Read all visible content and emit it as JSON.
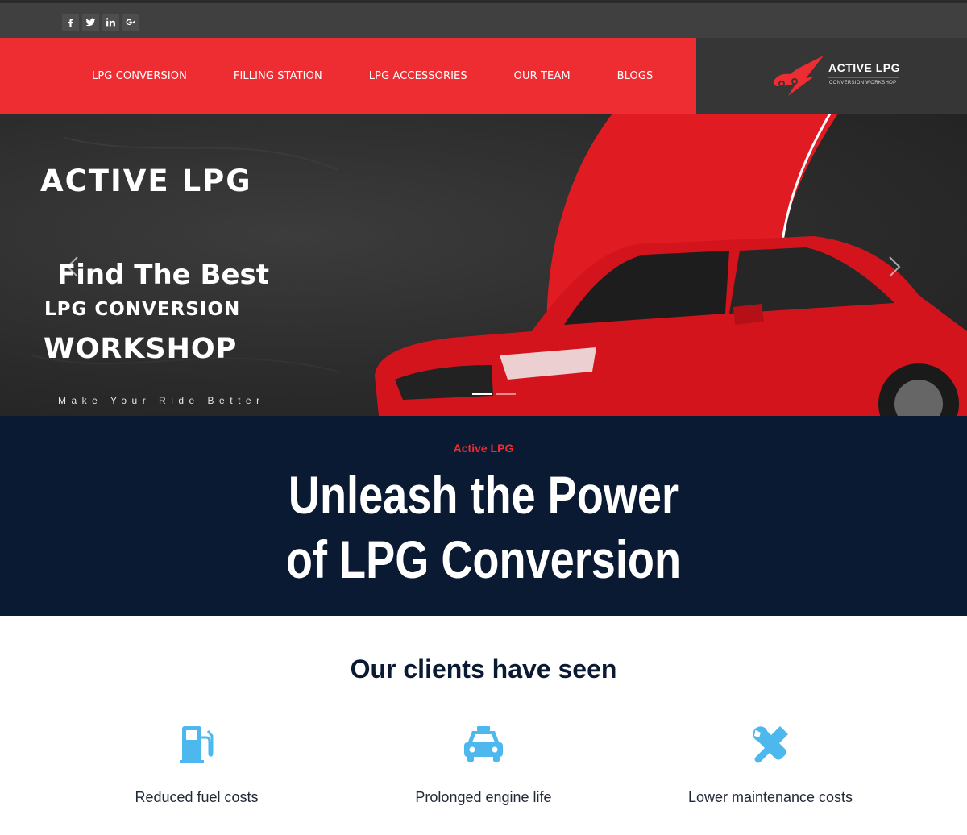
{
  "social": [
    "facebook-icon",
    "twitter-icon",
    "linkedin-icon",
    "google-plus-icon"
  ],
  "nav": {
    "items": [
      "LPG CONVERSION",
      "FILLING STATION",
      "LPG ACCESSORIES",
      "OUR TEAM",
      "BLOGS"
    ]
  },
  "brand": {
    "name": "ACTIVE LPG",
    "subtitle": "CONVERSION WORKSHOP",
    "accent": "#ee2d32"
  },
  "hero": {
    "title": "ACTIVE LPG",
    "line1": "Find The Best",
    "line2": "LPG CONVERSION",
    "line3": "WORKSHOP",
    "tagline": "Make Your Ride Better",
    "slides": 3,
    "active_slide": 1
  },
  "banner": {
    "kicker": "Active LPG",
    "title_line1": "Unleash the Power",
    "title_line2": "of LPG Conversion",
    "background": "#0b1a33"
  },
  "benefits": {
    "title": "Our clients have seen",
    "items": [
      {
        "icon": "fuel-pump-icon",
        "label": "Reduced fuel costs"
      },
      {
        "icon": "car-icon",
        "label": "Prolonged engine life"
      },
      {
        "icon": "tools-icon",
        "label": "Lower maintenance costs"
      }
    ],
    "icon_color": "#4db8ee"
  }
}
